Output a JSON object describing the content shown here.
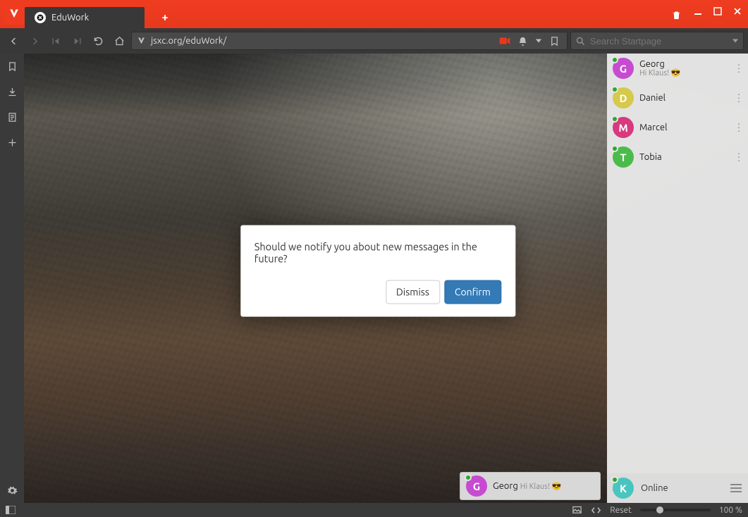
{
  "window": {
    "tab_title": "EduWork",
    "url": "jsxc.org/eduWork/",
    "search_placeholder": "Search Startpage"
  },
  "statusbar": {
    "reset_label": "Reset",
    "zoom_label": "100 %"
  },
  "modal": {
    "message": "Should we notify you about new messages in the future?",
    "dismiss_label": "Dismiss",
    "confirm_label": "Confirm"
  },
  "chat": {
    "contacts": [
      {
        "initial": "G",
        "name": "Georg",
        "msg": "Hi Klaus! 😎",
        "color": "#c74bd0",
        "status": "online"
      },
      {
        "initial": "D",
        "name": "Daniel",
        "msg": "",
        "color": "#d6c94b",
        "status": "online"
      },
      {
        "initial": "M",
        "name": "Marcel",
        "msg": "",
        "color": "#d8397c",
        "status": "online"
      },
      {
        "initial": "T",
        "name": "Tobia",
        "msg": "",
        "color": "#4bbb4b",
        "status": "online"
      }
    ],
    "self": {
      "initial": "K",
      "status_label": "Online",
      "color": "#49c5bf"
    }
  },
  "chip": {
    "initial": "G",
    "name": "Georg",
    "msg": "Hi Klaus! 😎",
    "color": "#c74bd0"
  }
}
